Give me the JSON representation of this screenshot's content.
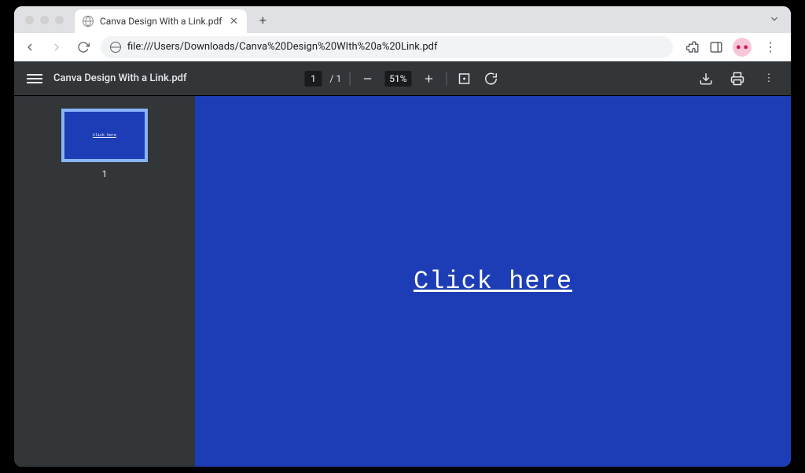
{
  "browser": {
    "tab_title": "Canva Design With a Link.pdf",
    "url": "file:///Users/Downloads/Canva%20Design%20WIth%20a%20Link.pdf",
    "avatar_glyph": "● ●"
  },
  "pdf": {
    "title": "Canva Design With a Link.pdf",
    "page_current": "1",
    "page_total": "1",
    "zoom": "51%",
    "thumbnails": [
      {
        "number": "1",
        "preview_text": "Click here"
      }
    ],
    "document": {
      "link_text": "Click here",
      "background_color": "#1c3db5"
    }
  }
}
